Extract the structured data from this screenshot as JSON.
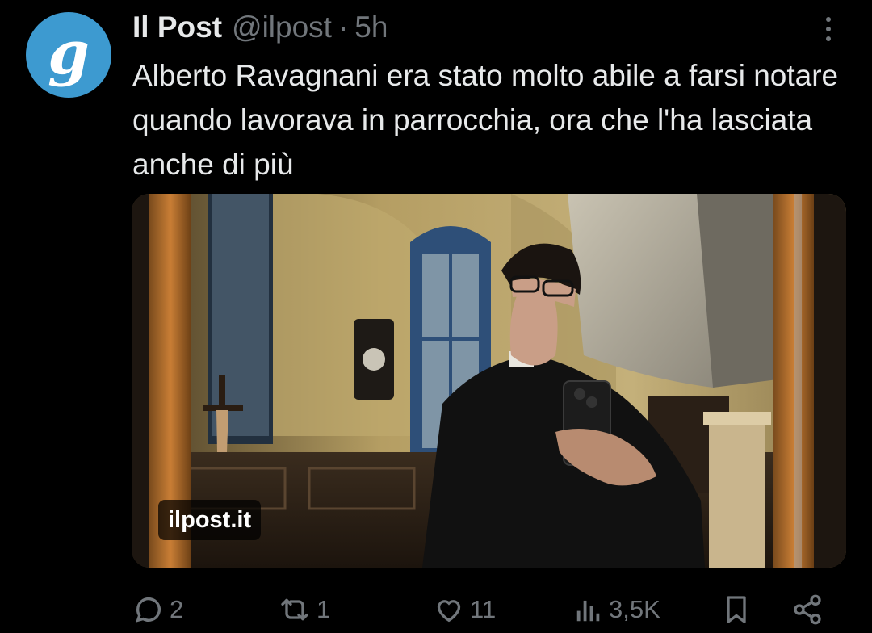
{
  "tweet": {
    "author": {
      "display_name": "Il Post",
      "handle": "@ilpost",
      "avatar_letter": "g",
      "avatar_color": "#3d9ad0"
    },
    "separator": "·",
    "time_ago": "5h",
    "text": "Alberto Ravagnani era stato molto abile a farsi notare quando lavorava in parrocchia, ora che l'ha lasciata anche di più",
    "media": {
      "link_domain": "ilpost.it"
    },
    "actions": {
      "replies": "2",
      "reposts": "1",
      "likes": "11",
      "views": "3,5K"
    }
  },
  "colors": {
    "background": "#000000",
    "text_primary": "#e7e9ea",
    "text_secondary": "#71767b"
  }
}
